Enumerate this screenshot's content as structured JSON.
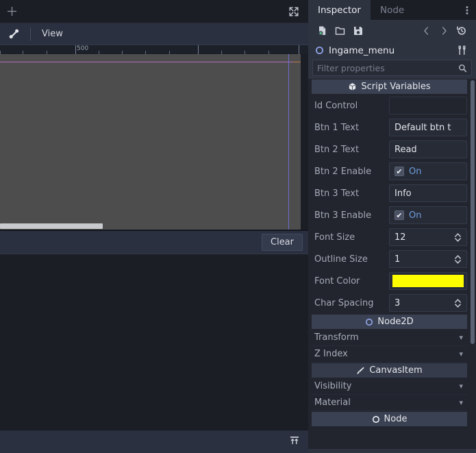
{
  "viewport": {
    "plus_tab_icon": "plus-icon",
    "expand_icon": "fullscreen-expand-icon",
    "tool_icon": "bone-tool-icon",
    "view_menu_label": "View",
    "ruler": {
      "label": "500",
      "label_x": 110
    },
    "hscrollbar": {
      "thumb_width": 150
    }
  },
  "output": {
    "clear_label": "Clear",
    "align_icon": "align-top-icon"
  },
  "inspector": {
    "tabs": [
      {
        "label": "Inspector",
        "active": true
      },
      {
        "label": "Node",
        "active": false
      }
    ],
    "kebab_icon": "more-vertical-icon",
    "toolbar": {
      "new_resource_icon": "new-resource-icon",
      "open_icon": "folder-open-icon",
      "save_icon": "save-floppy-icon",
      "back_icon": "chevron-left-icon",
      "forward_icon": "chevron-right-icon",
      "history_icon": "history-icon"
    },
    "object": {
      "icon": "node2d-circle-icon",
      "name": "Ingame_menu",
      "tools_icon": "object-tools-icon"
    },
    "filter": {
      "placeholder": "Filter properties",
      "search_icon": "search-icon"
    },
    "script_variables": {
      "icon": "script-cube-icon",
      "title": "Script Variables",
      "properties": [
        {
          "label": "Id Control",
          "type": "text",
          "value": "",
          "empty": true
        },
        {
          "label": "Btn 1 Text",
          "type": "text",
          "value": "Default btn t"
        },
        {
          "label": "Btn 2 Text",
          "type": "text",
          "value": "Read"
        },
        {
          "label": "Btn 2 Enable",
          "type": "bool",
          "value": "On",
          "checked": true
        },
        {
          "label": "Btn 3 Text",
          "type": "text",
          "value": "Info"
        },
        {
          "label": "Btn 3 Enable",
          "type": "bool",
          "value": "On",
          "checked": true
        },
        {
          "label": "Font Size",
          "type": "spin",
          "value": "12"
        },
        {
          "label": "Outline Size",
          "type": "spin",
          "value": "1"
        },
        {
          "label": "Font Color",
          "type": "color",
          "value": "#ffff00"
        },
        {
          "label": "Char Spacing",
          "type": "spin",
          "value": "3"
        }
      ]
    },
    "sections": [
      {
        "kind": "category",
        "icon": "node2d-circle-icon",
        "title": "Node2D"
      },
      {
        "kind": "fold",
        "title": "Transform",
        "chevron": "chevron-down-icon"
      },
      {
        "kind": "fold",
        "title": "Z Index",
        "chevron": "chevron-down-icon"
      },
      {
        "kind": "category",
        "icon": "canvasitem-brush-icon",
        "title": "CanvasItem"
      },
      {
        "kind": "fold",
        "title": "Visibility",
        "chevron": "chevron-down-icon"
      },
      {
        "kind": "fold",
        "title": "Material",
        "chevron": "chevron-down-icon"
      },
      {
        "kind": "category",
        "icon": "node-circle-icon",
        "title": "Node"
      }
    ]
  },
  "colors": {
    "accent_bool": "#6f9fe0",
    "font_color_swatch": "#ffff00",
    "panel_bg": "#22252e",
    "canvas_bg": "#4d4d4d",
    "guide_line": "#b06ec0"
  }
}
